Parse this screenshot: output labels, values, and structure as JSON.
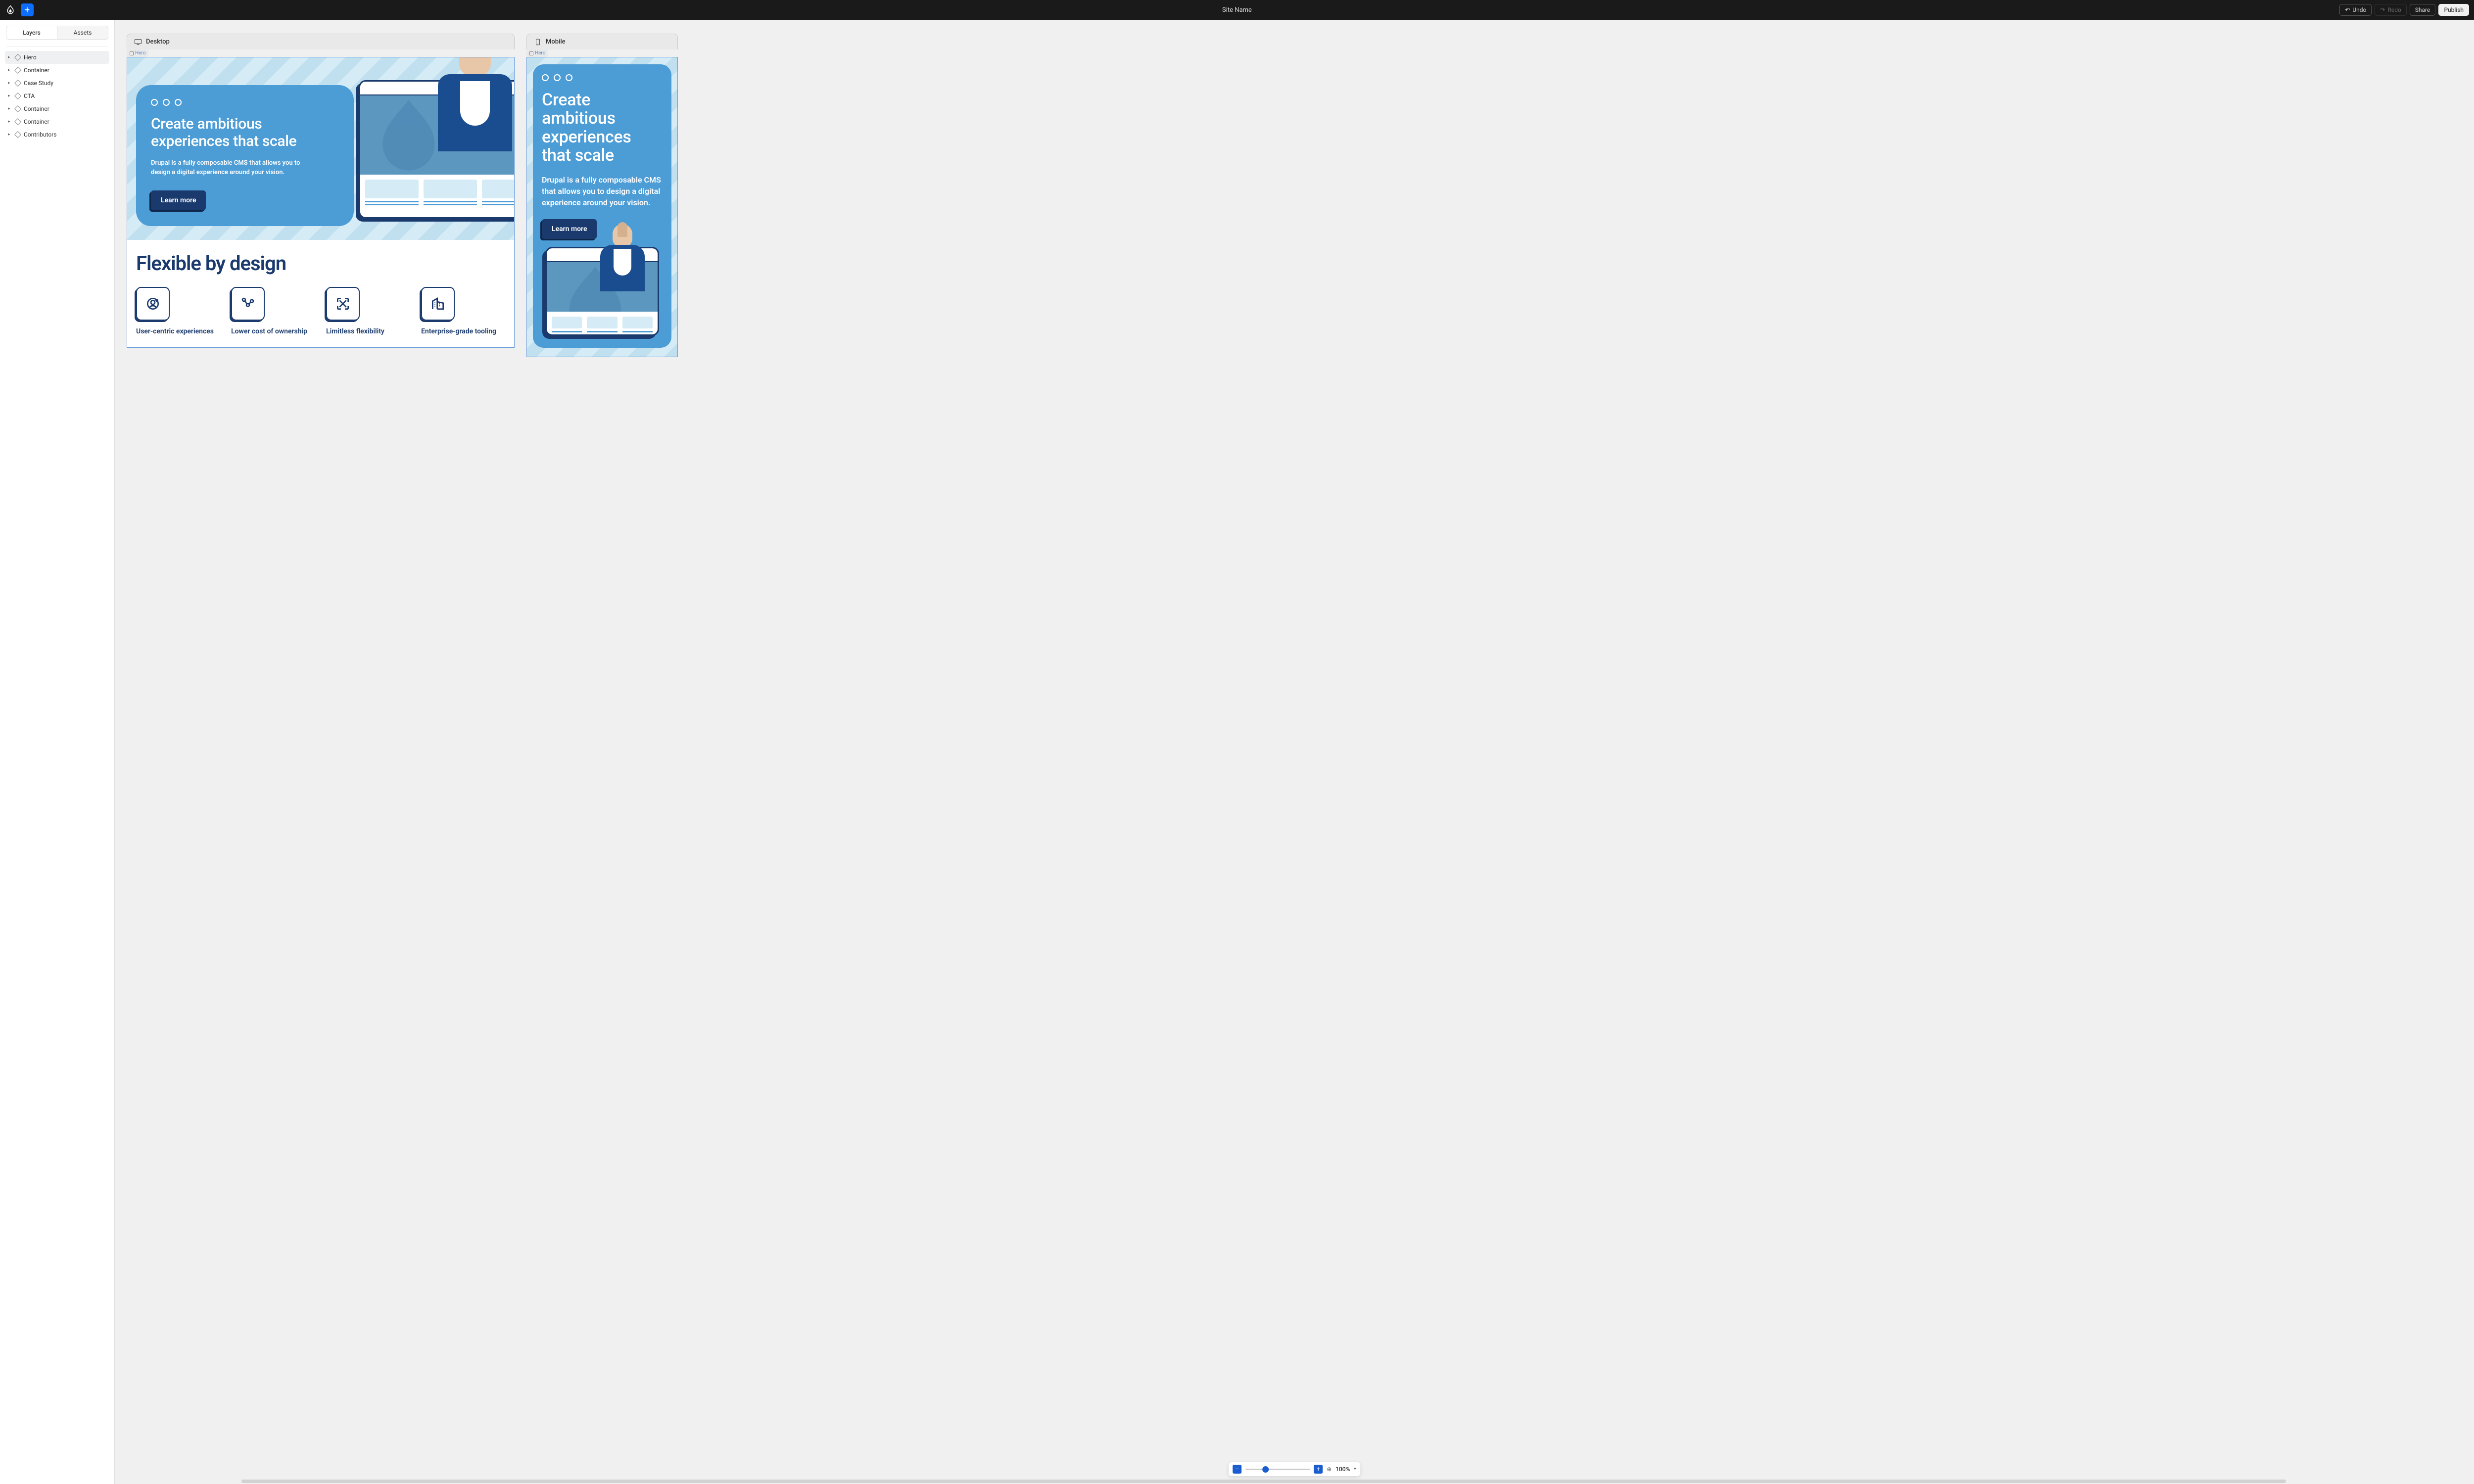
{
  "topbar": {
    "site_title": "Site Name",
    "undo_label": "Undo",
    "redo_label": "Redo",
    "share_label": "Share",
    "publish_label": "Publish"
  },
  "sidebar": {
    "tabs": {
      "layers": "Layers",
      "assets": "Assets"
    },
    "layers": [
      {
        "label": "Hero"
      },
      {
        "label": "Container"
      },
      {
        "label": "Case Study"
      },
      {
        "label": "CTA"
      },
      {
        "label": "Container"
      },
      {
        "label": "Container"
      },
      {
        "label": "Contributors"
      }
    ]
  },
  "frames": {
    "desktop": {
      "label": "Desktop",
      "hero_tag": "Hero"
    },
    "mobile": {
      "label": "Mobile",
      "hero_tag": "Hero"
    }
  },
  "hero": {
    "title": "Create ambitious experiences that scale",
    "subtitle": "Drupal is a fully composable CMS that allows you to design a digital experience around your vision.",
    "cta": "Learn more"
  },
  "flex": {
    "title": "Flexible by design",
    "items": [
      {
        "label": "User-centric experiences"
      },
      {
        "label": "Lower cost of ownership"
      },
      {
        "label": "Limitless flexibility"
      },
      {
        "label": "Enterprise-grade tooling"
      }
    ]
  },
  "zoom": {
    "value": "100%"
  }
}
